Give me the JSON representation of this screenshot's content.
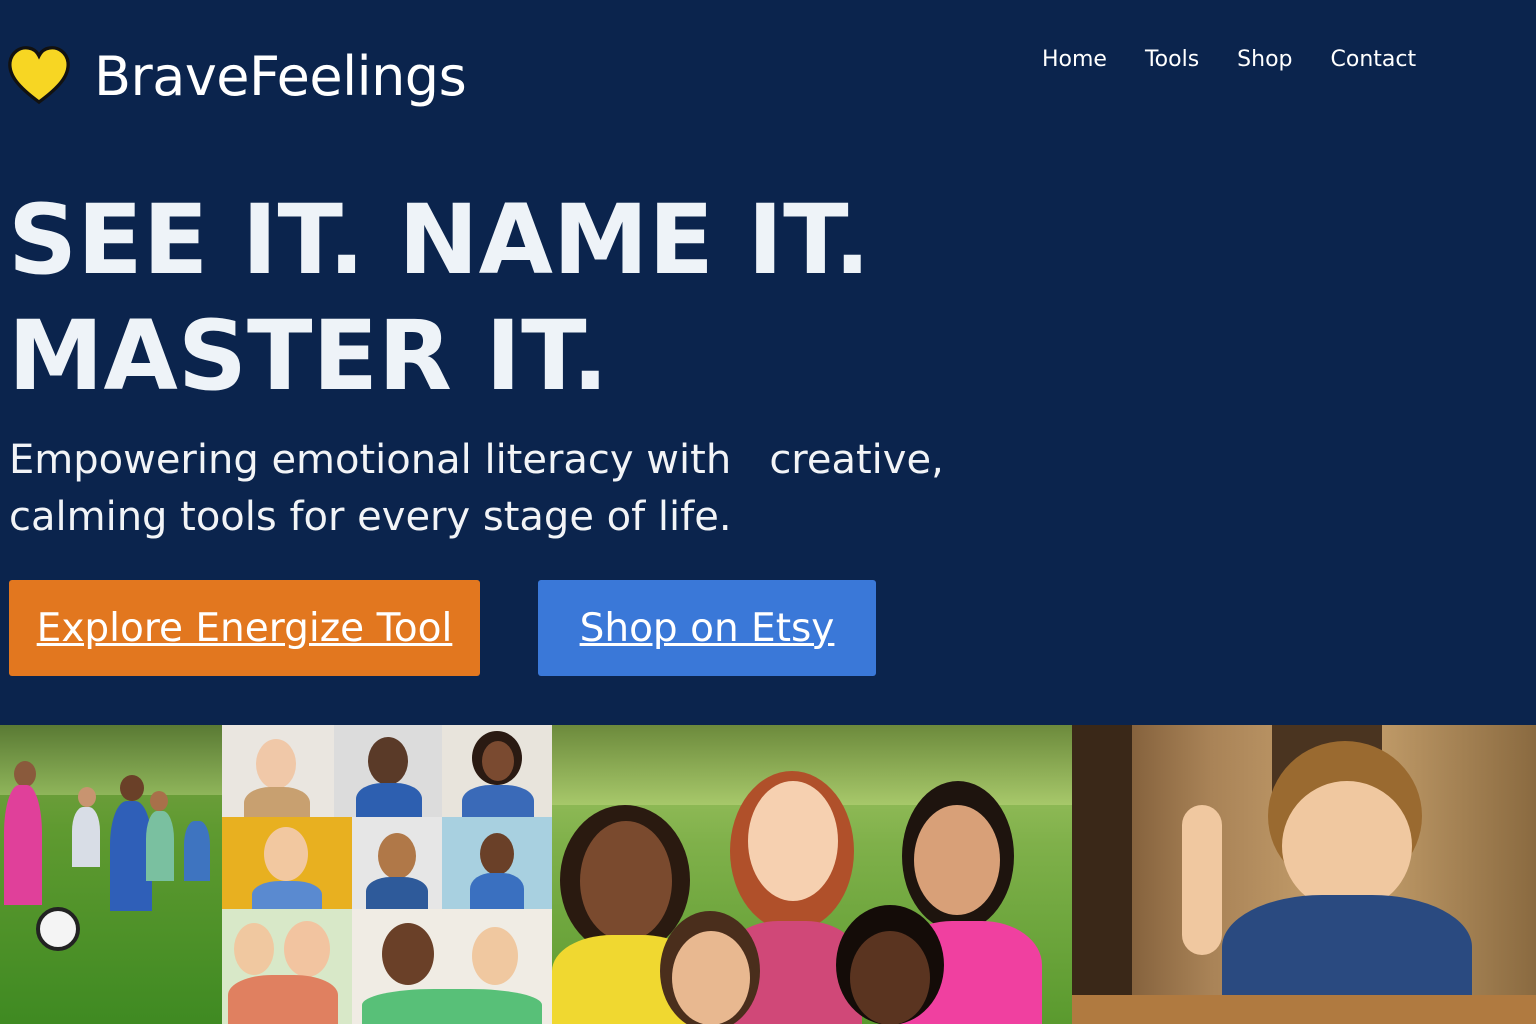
{
  "brand": {
    "name": "BraveFeelings",
    "logo_icon": "heart-icon",
    "logo_color": "#f7d623"
  },
  "nav": {
    "items": [
      {
        "label": "Home"
      },
      {
        "label": "Tools"
      },
      {
        "label": "Shop"
      },
      {
        "label": "Contact"
      }
    ]
  },
  "hero": {
    "headline_line1": "SEE IT. NAME IT.",
    "headline_line2": "MASTER IT.",
    "subtitle_line1": "Empowering emotional literacy with   creative,",
    "subtitle_line2": "calming tools for every stage of life.",
    "primary_button": "Explore Energize Tool",
    "secondary_button": "Shop on Etsy"
  },
  "colors": {
    "background": "#0b244d",
    "primary_button": "#e2771f",
    "secondary_button": "#3a78d8"
  }
}
